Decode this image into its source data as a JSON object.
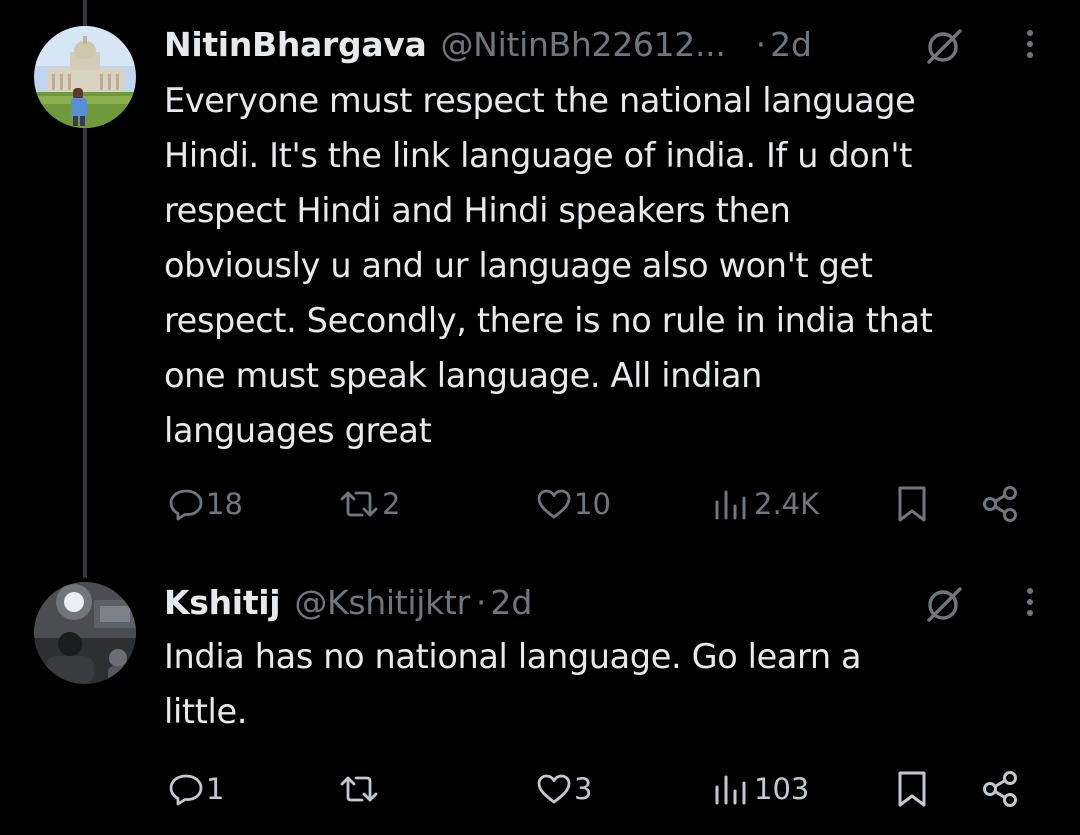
{
  "tweets": [
    {
      "display_name": "NitinBhargava",
      "handle": "@NitinBh22612...",
      "separator": "·",
      "time": "2d",
      "text": "Everyone must respect the national language\nHindi. It's the link language of india. If u don't\nrespect Hindi and Hindi speakers  then\nobviously u and ur language also won't get\nrespect. Secondly, there is no rule in india that\none must speak language. All indian\nlanguages great",
      "actions": {
        "replies": "18",
        "reposts": "2",
        "likes": "10",
        "views": "2.4K"
      }
    },
    {
      "display_name": "Kshitij",
      "handle": "@Kshitijktr",
      "separator": "·",
      "time": "2d",
      "text": "India has no national language. Go learn a\nlittle.",
      "actions": {
        "replies": "1",
        "reposts": "",
        "likes": "3",
        "views": "103"
      }
    }
  ],
  "icons": {
    "reply": "reply-icon",
    "repost": "repost-icon",
    "like": "heart-icon",
    "views": "views-icon",
    "bookmark": "bookmark-icon",
    "share": "share-icon",
    "grok": "grok-icon",
    "more": "more-vertical-icon"
  },
  "colors": {
    "background": "#000000",
    "text_primary": "#e7e9ea",
    "text_secondary": "#71767b",
    "thread_line": "#333639"
  }
}
